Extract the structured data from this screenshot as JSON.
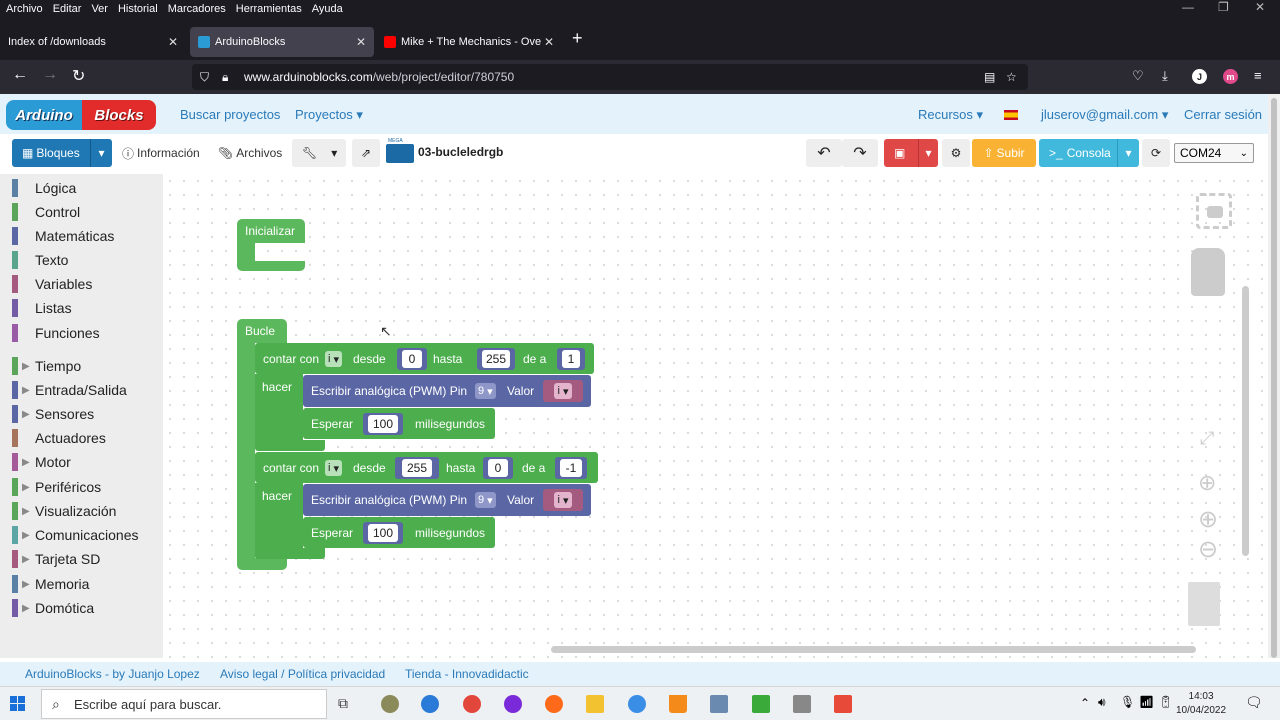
{
  "browser": {
    "menu": [
      "Archivo",
      "Editar",
      "Ver",
      "Historial",
      "Marcadores",
      "Herramientas",
      "Ayuda"
    ],
    "tabs": [
      {
        "label": "Index of /downloads"
      },
      {
        "label": "ArduinoBlocks"
      },
      {
        "label": "Mike + The Mechanics - Over M"
      }
    ],
    "url_host": "www.arduinoblocks.com",
    "url_path": "/web/project/editor/780750",
    "profile_initial": "J"
  },
  "header": {
    "logo_left": "Arduino",
    "logo_right": "Blocks",
    "nav": [
      "Buscar proyectos",
      "Proyectos ▾"
    ],
    "resources": "Recursos ▾",
    "user": "jluserov@gmail.com ▾",
    "logout": "Cerrar sesión"
  },
  "toolbar": {
    "blocks": "Bloques",
    "info": "Información",
    "files": "Archivos",
    "board_label": "MEGA",
    "project_name": "03-bucleledrgb",
    "upload": "Subir",
    "console": "Consola",
    "port": "COM24"
  },
  "toolbox": {
    "categories": [
      {
        "label": "Lógica",
        "color": "#5b80a5"
      },
      {
        "label": "Control",
        "color": "#5ba55b"
      },
      {
        "label": "Matemáticas",
        "color": "#5b67a5"
      },
      {
        "label": "Texto",
        "color": "#5ba58c"
      },
      {
        "label": "Variables",
        "color": "#a55b80"
      },
      {
        "label": "Listas",
        "color": "#745ba5"
      },
      {
        "label": "Funciones",
        "color": "#995ba5"
      },
      {
        "label": "Tiempo",
        "color": "#5ba55b"
      },
      {
        "label": "Entrada/Salida",
        "color": "#5b67a5"
      },
      {
        "label": "Sensores",
        "color": "#5b67a5"
      },
      {
        "label": "Actuadores",
        "color": "#a5745b"
      },
      {
        "label": "Motor",
        "color": "#a55b99"
      },
      {
        "label": "Periféricos",
        "color": "#5ba55b"
      },
      {
        "label": "Visualización",
        "color": "#5ba55b"
      },
      {
        "label": "Comunicaciones",
        "color": "#5ba5a5"
      },
      {
        "label": "Tarjeta SD",
        "color": "#a55b80"
      },
      {
        "label": "Memoria",
        "color": "#5b80a5"
      },
      {
        "label": "Domótica",
        "color": "#745ba5"
      }
    ]
  },
  "blocks": {
    "init_label": "Inicializar",
    "loop_label": "Bucle",
    "for1": {
      "count_with": "contar con",
      "var": "i",
      "from_label": "desde",
      "from": "0",
      "to_label": "hasta",
      "to": "255",
      "by_label": "de a",
      "by": "1",
      "do_label": "hacer"
    },
    "for2": {
      "count_with": "contar con",
      "var": "i",
      "from_label": "desde",
      "from": "255",
      "to_label": "hasta",
      "to": "0",
      "by_label": "de a",
      "by": "-1",
      "do_label": "hacer"
    },
    "pwm_label": "Escribir analógica (PWM) Pin",
    "pin": "9",
    "value_label": "Valor",
    "value_var": "i",
    "wait_label": "Esperar",
    "wait_ms": "100",
    "ms_label": "milisegundos"
  },
  "footer": {
    "links": [
      "ArduinoBlocks - by Juanjo Lopez",
      "Aviso legal / Política privacidad",
      "Tienda - Innovadidactic"
    ]
  },
  "taskbar": {
    "search_placeholder": "Escribe aquí para buscar.",
    "time": "14:03",
    "date": "10/04/2022"
  },
  "colors": {
    "control_block": "#5cb85c",
    "math_block": "#5b67a5",
    "var_block": "#a55b80",
    "brand_blue": "#2b9bd6",
    "brand_red": "#e22b2b"
  }
}
